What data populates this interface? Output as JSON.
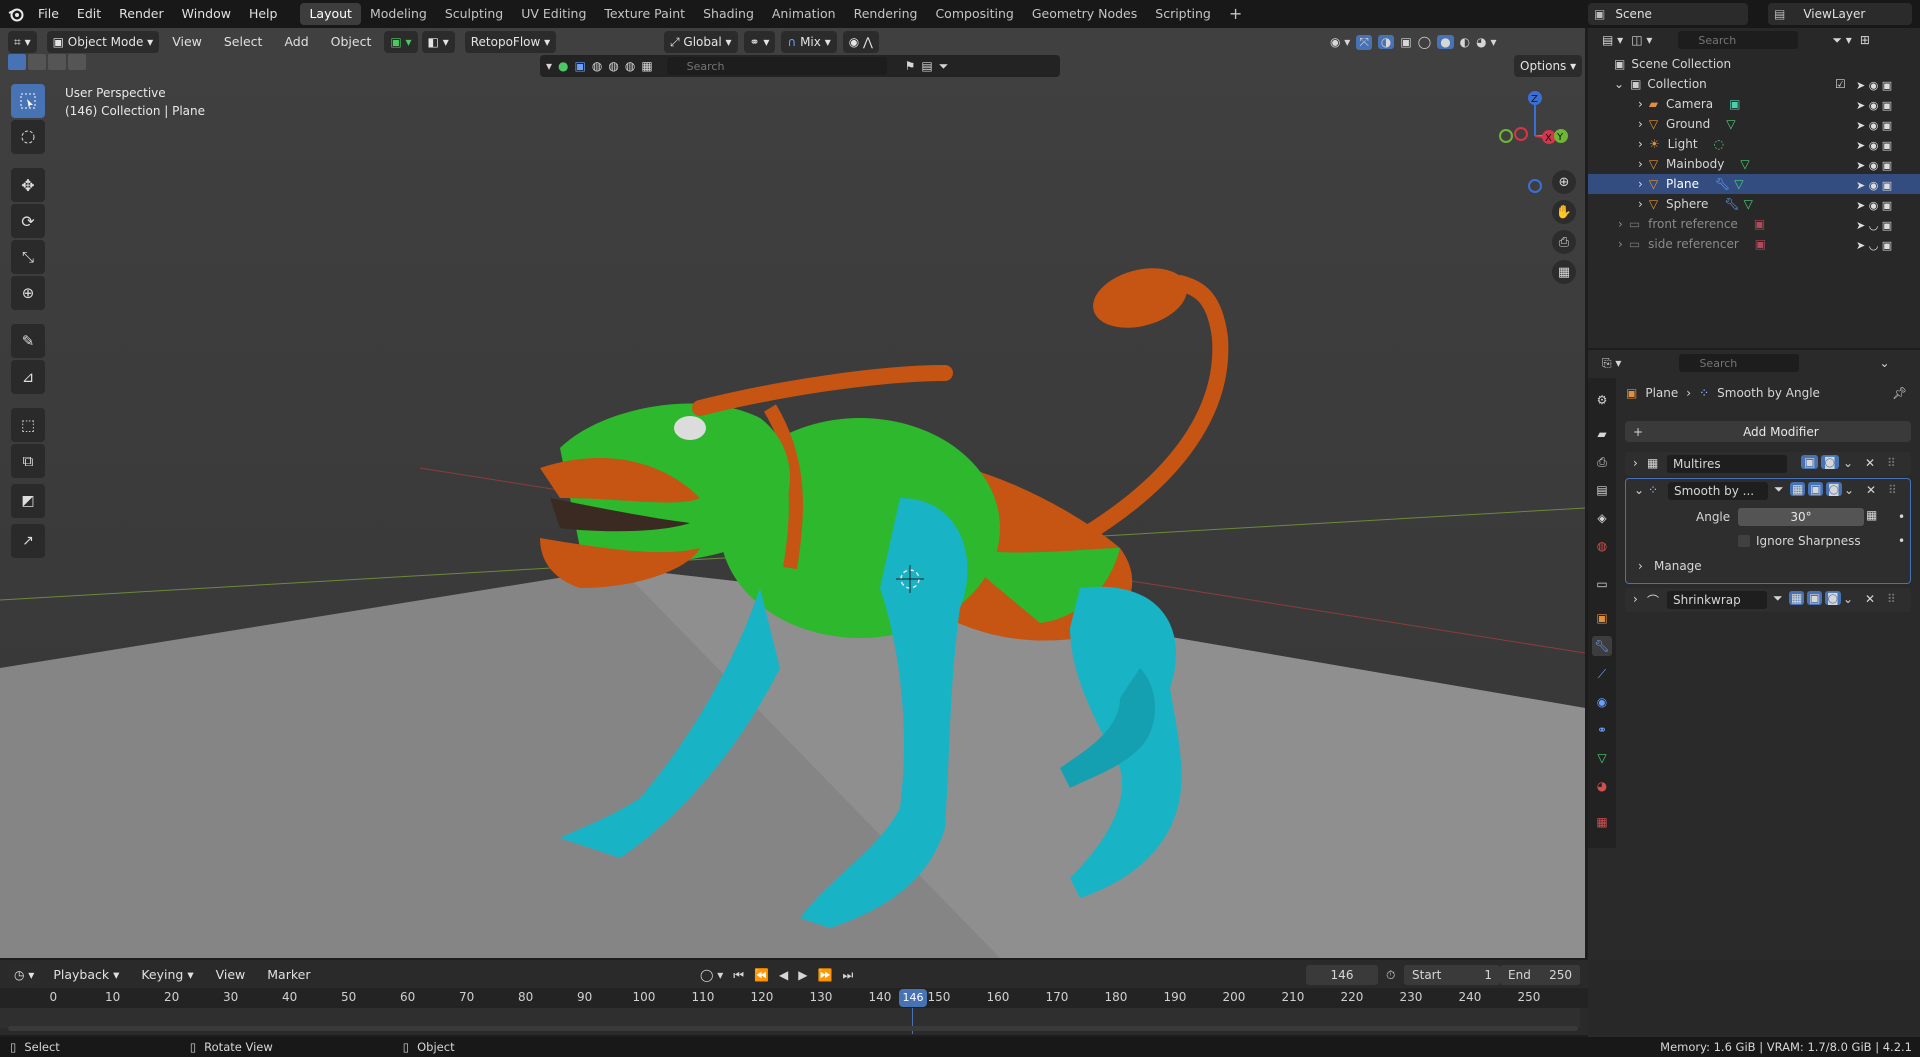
{
  "menu": {
    "items": [
      "File",
      "Edit",
      "Render",
      "Window",
      "Help"
    ]
  },
  "workspaces": [
    "Layout",
    "Modeling",
    "Sculpting",
    "UV Editing",
    "Texture Paint",
    "Shading",
    "Animation",
    "Rendering",
    "Compositing",
    "Geometry Nodes",
    "Scripting"
  ],
  "scene": {
    "name": "Scene",
    "view_layer": "ViewLayer"
  },
  "viewport": {
    "mode": "Object Mode",
    "menus": [
      "View",
      "Select",
      "Add",
      "Object"
    ],
    "addon": "RetopoFlow",
    "transform": "Global",
    "snap": "Mix",
    "search_placeholder": "Search",
    "options": "Options",
    "perspective": "User Perspective",
    "context": "(146) Collection | Plane",
    "gizmo": {
      "z": "Z",
      "x": "X",
      "y": "Y"
    }
  },
  "outliner": {
    "search_placeholder": "Search",
    "root": "Scene Collection",
    "collection": "Collection",
    "items": [
      {
        "name": "Camera"
      },
      {
        "name": "Ground"
      },
      {
        "name": "Light"
      },
      {
        "name": "Mainbody"
      },
      {
        "name": "Plane"
      },
      {
        "name": "Sphere"
      },
      {
        "name": "front reference"
      },
      {
        "name": "side referencer"
      }
    ]
  },
  "properties": {
    "search_placeholder": "Search",
    "breadcrumb_object": "Plane",
    "breadcrumb_modifier": "Smooth by Angle",
    "add_modifier": "Add Modifier",
    "modifiers": [
      {
        "name": "Multires"
      },
      {
        "name": "Smooth by ..."
      },
      {
        "name": "Shrinkwrap"
      }
    ],
    "angle_label": "Angle",
    "angle_value": "30°",
    "ignore_sharpness": "Ignore Sharpness",
    "manage": "Manage"
  },
  "timeline": {
    "menus": [
      "Playback",
      "Keying",
      "View",
      "Marker"
    ],
    "current_frame": "146",
    "start_label": "Start",
    "start": "1",
    "end_label": "End",
    "end": "250",
    "ticks": [
      "0",
      "10",
      "20",
      "30",
      "40",
      "50",
      "60",
      "70",
      "80",
      "90",
      "100",
      "110",
      "120",
      "130",
      "140",
      "150",
      "160",
      "170",
      "180",
      "190",
      "200",
      "210",
      "220",
      "230",
      "240",
      "250"
    ]
  },
  "status": {
    "select": "Select",
    "rotate": "Rotate View",
    "object": "Object",
    "memory": "Memory: 1.6 GiB | VRAM: 1.7/8.0 GiB | 4.2.1"
  },
  "colors": {
    "accent": "#4772b3",
    "creature_green": "#2db82d",
    "creature_orange": "#c65412",
    "creature_cyan": "#18b4c6",
    "floor": "#8a8a8a"
  }
}
